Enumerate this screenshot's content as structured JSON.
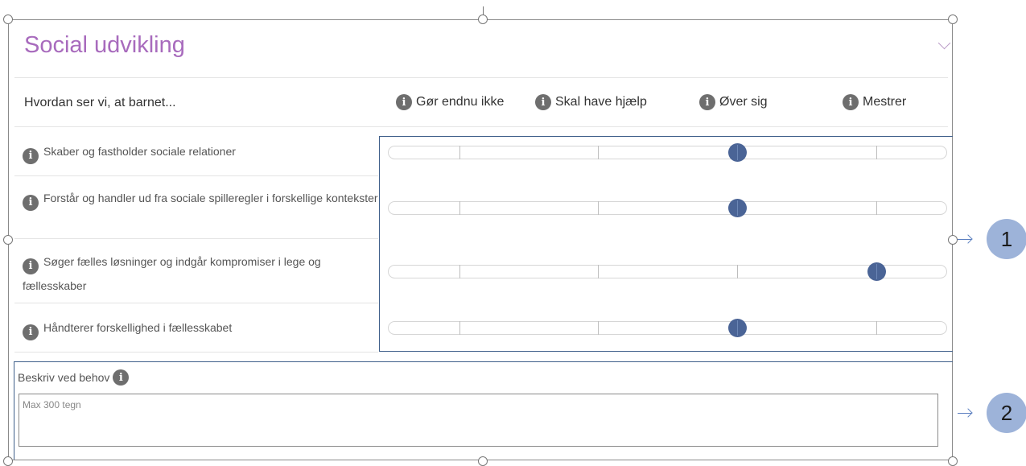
{
  "section": {
    "title": "Social udvikling"
  },
  "table": {
    "question_header": "Hvordan ser vi, at barnet...",
    "columns": [
      "Gør endnu ikke",
      "Skal have hjælp",
      "Øver sig",
      "Mestrer"
    ],
    "rows": [
      {
        "label": "Skaber og fastholder sociale relationer",
        "level": 3
      },
      {
        "label": "Forstår og handler ud fra sociale spilleregler i forskellige kontekster",
        "level": 3
      },
      {
        "label": "Søger fælles løsninger og indgår kompromiser i lege og fællesskaber",
        "level": 4
      },
      {
        "label": "Håndterer forskellighed i fællesskabet",
        "level": 3
      }
    ]
  },
  "description": {
    "label": "Beskriv ved behov",
    "placeholder": "Max 300 tegn"
  },
  "callouts": [
    "1",
    "2"
  ],
  "colors": {
    "title": "#a86bbd",
    "thumb": "#4a6496",
    "callout": "#9db3d9"
  },
  "icons": {
    "info": "info-icon",
    "chevron": "chevron-down-icon"
  }
}
